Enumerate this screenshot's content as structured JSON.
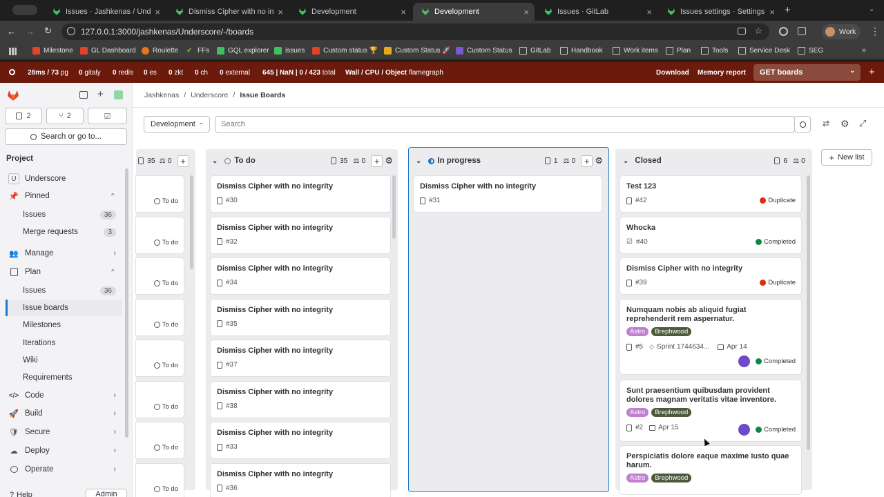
{
  "browser": {
    "tabs": [
      {
        "label": "Issues · Jashkenas / Underscore"
      },
      {
        "label": "Dismiss Cipher with no integrity"
      },
      {
        "label": "Development"
      },
      {
        "label": "Development"
      },
      {
        "label": "Issues · GitLab"
      },
      {
        "label": "Issues settings · Settings · Jas"
      }
    ],
    "url": "127.0.0.1:3000/jashkenas/Underscore/-/boards",
    "profile": "Work",
    "bookmarks": [
      "Milestone",
      "GL Dashboard",
      "Roulette",
      "FFs",
      "GQL explorer",
      "issues",
      "Custom status 🏆",
      "Custom Status 🚀",
      "Custom Status",
      "GitLab",
      "Handbook",
      "Work items",
      "Plan",
      "Tools",
      "Service Desk",
      "SEG"
    ]
  },
  "perf": {
    "pg": "28ms / 73",
    "pg_unit": "pg",
    "gitaly": "0",
    "redis": "0",
    "es": "0",
    "zkt": "0",
    "ch": "0",
    "external": "0",
    "total_a": "645 | NaN | 0 / 423",
    "total_label": "total",
    "wall": "Wall / CPU / Object",
    "flame": "flamegraph",
    "download": "Download",
    "memory": "Memory report",
    "request": "GET boards"
  },
  "sidebar": {
    "counts": {
      "issues": "2",
      "mrs": "2"
    },
    "search": "Search or go to...",
    "section": "Project",
    "project_initial": "U",
    "project": "Underscore",
    "pinned": "Pinned",
    "pinned_issues": "Issues",
    "pinned_issues_count": "36",
    "pinned_mrs": "Merge requests",
    "pinned_mrs_count": "3",
    "manage": "Manage",
    "plan": "Plan",
    "plan_items": [
      {
        "label": "Issues",
        "count": "36"
      },
      {
        "label": "Issue boards"
      },
      {
        "label": "Milestones"
      },
      {
        "label": "Iterations"
      },
      {
        "label": "Wiki"
      },
      {
        "label": "Requirements"
      }
    ],
    "code": "Code",
    "build": "Build",
    "secure": "Secure",
    "deploy": "Deploy",
    "operate": "Operate",
    "help": "Help",
    "admin": "Admin"
  },
  "breadcrumb": [
    "Jashkenas",
    "Underscore",
    "Issue Boards"
  ],
  "board": {
    "selector": "Development",
    "search_placeholder": "Search",
    "new_list": "New list",
    "partial_list": {
      "count": "35",
      "weight": "0",
      "status": "To do",
      "cards": 8
    },
    "todo": {
      "title": "To do",
      "count": "35",
      "weight": "0",
      "cards": [
        {
          "title": "Dismiss Cipher with no integrity",
          "num": "#30"
        },
        {
          "title": "Dismiss Cipher with no integrity",
          "num": "#32"
        },
        {
          "title": "Dismiss Cipher with no integrity",
          "num": "#34"
        },
        {
          "title": "Dismiss Cipher with no integrity",
          "num": "#35"
        },
        {
          "title": "Dismiss Cipher with no integrity",
          "num": "#37"
        },
        {
          "title": "Dismiss Cipher with no integrity",
          "num": "#38"
        },
        {
          "title": "Dismiss Cipher with no integrity",
          "num": "#33"
        },
        {
          "title": "Dismiss Cipher with no integrity",
          "num": "#36"
        }
      ]
    },
    "inprogress": {
      "title": "In progress",
      "count": "1",
      "weight": "0",
      "cards": [
        {
          "title": "Dismiss Cipher with no integrity",
          "num": "#31"
        }
      ]
    },
    "closed": {
      "title": "Closed",
      "count": "6",
      "weight": "0",
      "cards": [
        {
          "title": "Test 123",
          "num": "#42",
          "status": "Duplicate"
        },
        {
          "title": "Whocka",
          "num": "#40",
          "status": "Completed"
        },
        {
          "title": "Dismiss Cipher with no integrity",
          "num": "#39",
          "status": "Duplicate"
        },
        {
          "title": "Numquam nobis ab aliquid fugiat reprehenderit rem aspernatur.",
          "num": "#5",
          "labels": [
            "Astro",
            "Brephwood"
          ],
          "sprint": "Sprint 1744634...",
          "date": "Apr 14",
          "status": "Completed"
        },
        {
          "title": "Sunt praesentium quibusdam provident dolores magnam veritatis vitae inventore.",
          "num": "#2",
          "labels": [
            "Astro",
            "Brephwood"
          ],
          "date": "Apr 15",
          "status": "Completed"
        },
        {
          "title": "Perspiciatis dolore eaque maxime iusto quae harum.",
          "labels": [
            "Astro",
            "Brephwood"
          ]
        }
      ]
    }
  },
  "colors": {
    "tabbar": "#1f1f1f",
    "perfbar": "#6b1a0c",
    "accent": "#1f75cb",
    "duplicate": "#dd2b0e",
    "completed": "#108548",
    "astro": "#c17fd0",
    "brephwood": "#4d5a3b"
  }
}
